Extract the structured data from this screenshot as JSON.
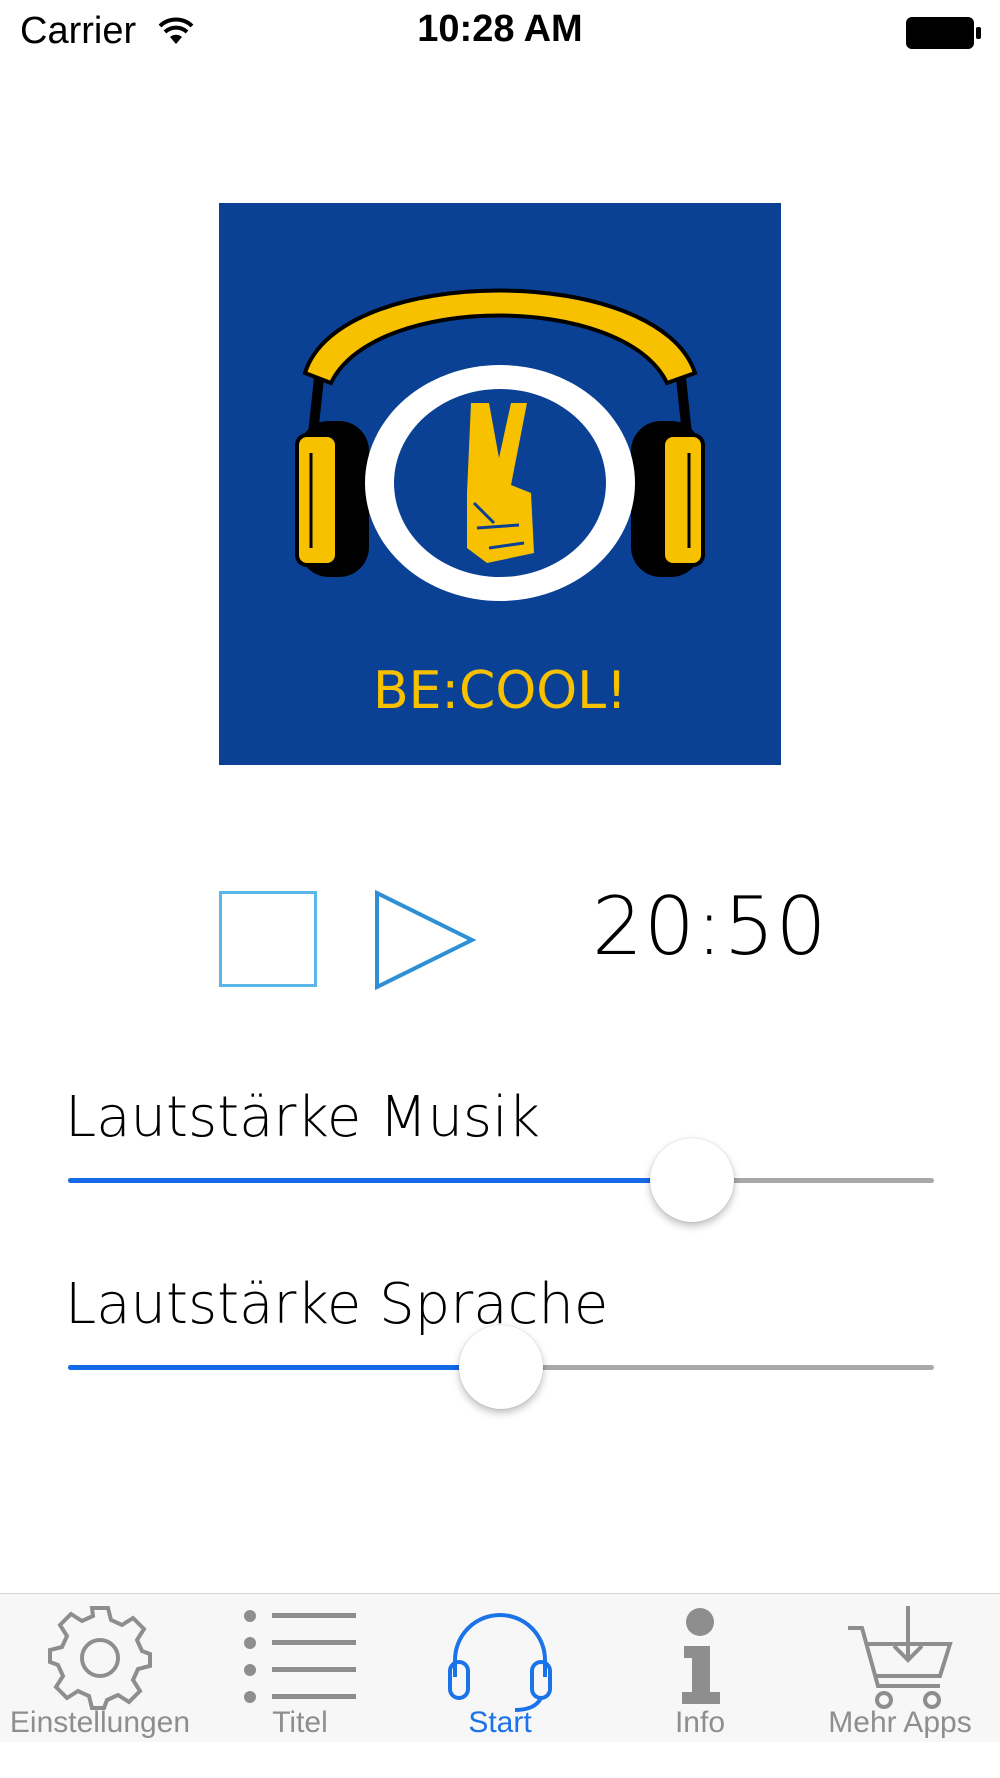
{
  "status_bar": {
    "carrier": "Carrier",
    "time": "10:28 AM"
  },
  "cover": {
    "brand_text": "BE:COOL!",
    "background_color": "#0a4194",
    "accent_color": "#f7c100"
  },
  "player": {
    "timer": "20:50",
    "stop_icon": "stop-square-icon",
    "play_icon": "play-triangle-icon"
  },
  "sliders": [
    {
      "label": "Lautstärke Musik",
      "value": 0.72
    },
    {
      "label": "Lautstärke Sprache",
      "value": 0.5
    }
  ],
  "tabs": [
    {
      "label": "Einstellungen",
      "icon": "gear-icon",
      "active": false
    },
    {
      "label": "Titel",
      "icon": "list-icon",
      "active": false
    },
    {
      "label": "Start",
      "icon": "headphones-icon",
      "active": true
    },
    {
      "label": "Info",
      "icon": "info-icon",
      "active": false
    },
    {
      "label": "Mehr Apps",
      "icon": "shopping-cart-icon",
      "active": false
    }
  ],
  "colors": {
    "accent": "#1a73e8",
    "slider_fill": "#1469e6",
    "inactive": "#8e8e8e"
  }
}
